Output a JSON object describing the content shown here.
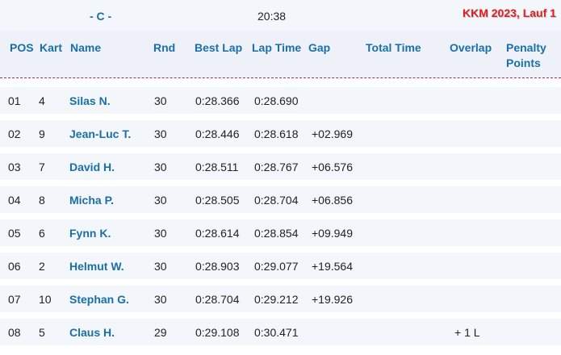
{
  "topbar": {
    "class_label": "- C -",
    "clock": "20:38",
    "event_title": "KKM 2023, Lauf 1"
  },
  "columns": {
    "pos": "POS",
    "kart": "Kart",
    "name": "Name",
    "rnd": "Rnd",
    "best_lap": "Best Lap",
    "lap_time": "Lap Time",
    "gap": "Gap",
    "total_time": "Total Time",
    "overlap": "Overlap",
    "penalty_line1": "Penalty",
    "penalty_line2": "Points"
  },
  "rows": [
    {
      "pos": "01",
      "kart": "4",
      "name": "Silas N.",
      "rnd": "30",
      "best_lap": "0:28.366",
      "lap_time": "0:28.690",
      "gap": "",
      "total_time": "",
      "overlap": "",
      "penalty": ""
    },
    {
      "pos": "02",
      "kart": "9",
      "name": "Jean-Luc T.",
      "rnd": "30",
      "best_lap": "0:28.446",
      "lap_time": "0:28.618",
      "gap": "+02.969",
      "total_time": "",
      "overlap": "",
      "penalty": ""
    },
    {
      "pos": "03",
      "kart": "7",
      "name": "David H.",
      "rnd": "30",
      "best_lap": "0:28.511",
      "lap_time": "0:28.767",
      "gap": "+06.576",
      "total_time": "",
      "overlap": "",
      "penalty": ""
    },
    {
      "pos": "04",
      "kart": "8",
      "name": "Micha P.",
      "rnd": "30",
      "best_lap": "0:28.505",
      "lap_time": "0:28.704",
      "gap": "+06.856",
      "total_time": "",
      "overlap": "",
      "penalty": ""
    },
    {
      "pos": "05",
      "kart": "6",
      "name": "Fynn K.",
      "rnd": "30",
      "best_lap": "0:28.614",
      "lap_time": "0:28.854",
      "gap": "+09.949",
      "total_time": "",
      "overlap": "",
      "penalty": ""
    },
    {
      "pos": "06",
      "kart": "2",
      "name": "Helmut W.",
      "rnd": "30",
      "best_lap": "0:28.903",
      "lap_time": "0:29.077",
      "gap": "+19.564",
      "total_time": "",
      "overlap": "",
      "penalty": ""
    },
    {
      "pos": "07",
      "kart": "10",
      "name": "Stephan G.",
      "rnd": "30",
      "best_lap": "0:28.704",
      "lap_time": "0:29.212",
      "gap": "+19.926",
      "total_time": "",
      "overlap": "",
      "penalty": ""
    },
    {
      "pos": "08",
      "kart": "5",
      "name": "Claus H.",
      "rnd": "29",
      "best_lap": "0:29.108",
      "lap_time": "0:30.471",
      "gap": "",
      "total_time": "",
      "overlap": "+ 1 L",
      "penalty": ""
    }
  ],
  "colors": {
    "accent": "#1a6fa8",
    "title_red": "#e02020",
    "row_bg": "#f3f6fa",
    "header_bg": "#eef2f8",
    "separator": "#b02a4a"
  }
}
